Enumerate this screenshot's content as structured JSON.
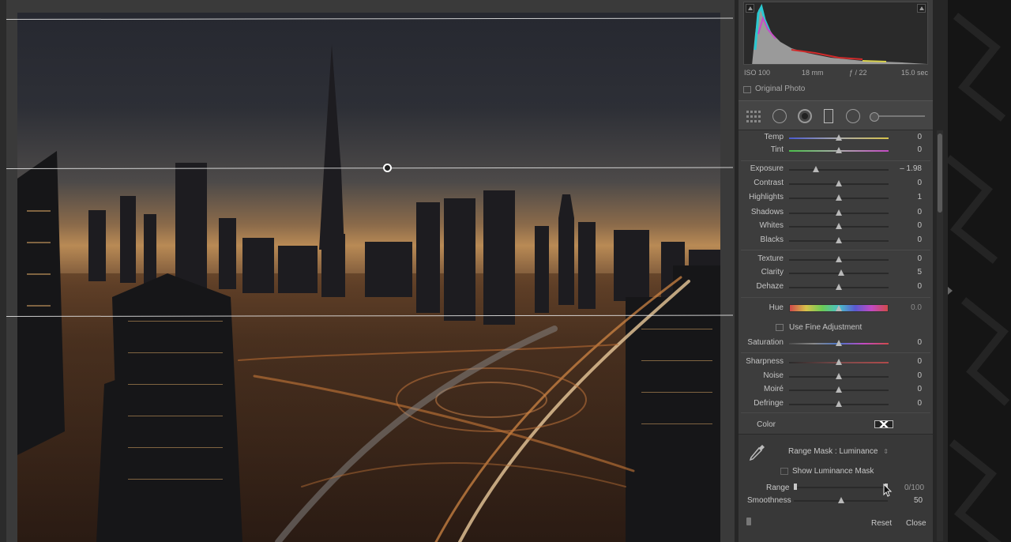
{
  "histogram": {
    "iso": "ISO 100",
    "focal": "18 mm",
    "aperture": "ƒ / 22",
    "shutter": "15.0 sec",
    "original_photo_label": "Original Photo"
  },
  "colors": {
    "panel_bg": "#3d3d3d",
    "accent_thumb": "#b8b8b8"
  },
  "adjustments": {
    "temp": {
      "label": "Temp",
      "value": "0",
      "level": 0.5
    },
    "tint": {
      "label": "Tint",
      "value": "0",
      "level": 0.5
    },
    "exposure": {
      "label": "Exposure",
      "value": "– 1.98",
      "level": 0.27
    },
    "contrast": {
      "label": "Contrast",
      "value": "0",
      "level": 0.5
    },
    "highlights": {
      "label": "Highlights",
      "value": "1",
      "level": 0.5
    },
    "shadows": {
      "label": "Shadows",
      "value": "0",
      "level": 0.5
    },
    "whites": {
      "label": "Whites",
      "value": "0",
      "level": 0.5
    },
    "blacks": {
      "label": "Blacks",
      "value": "0",
      "level": 0.5
    },
    "texture": {
      "label": "Texture",
      "value": "0",
      "level": 0.5
    },
    "clarity": {
      "label": "Clarity",
      "value": "5",
      "level": 0.52
    },
    "dehaze": {
      "label": "Dehaze",
      "value": "0",
      "level": 0.5
    },
    "hue": {
      "label": "Hue",
      "value": "0.0",
      "level": 0.5
    },
    "fine_adjust_label": "Use Fine Adjustment",
    "saturation": {
      "label": "Saturation",
      "value": "0",
      "level": 0.5
    },
    "sharpness": {
      "label": "Sharpness",
      "value": "0",
      "level": 0.5
    },
    "noise": {
      "label": "Noise",
      "value": "0",
      "level": 0.5
    },
    "moire": {
      "label": "Moiré",
      "value": "0",
      "level": 0.5
    },
    "defringe": {
      "label": "Defringe",
      "value": "0",
      "level": 0.5
    },
    "color_label": "Color"
  },
  "range_mask": {
    "title": "Range Mask : Luminance",
    "title_arrow": "⇕",
    "show_mask_label": "Show Luminance Mask",
    "range_label": "Range",
    "range_value": "0/100",
    "smoothness_label": "Smoothness",
    "smoothness_value": "50"
  },
  "footer": {
    "reset": "Reset",
    "close": "Close"
  }
}
